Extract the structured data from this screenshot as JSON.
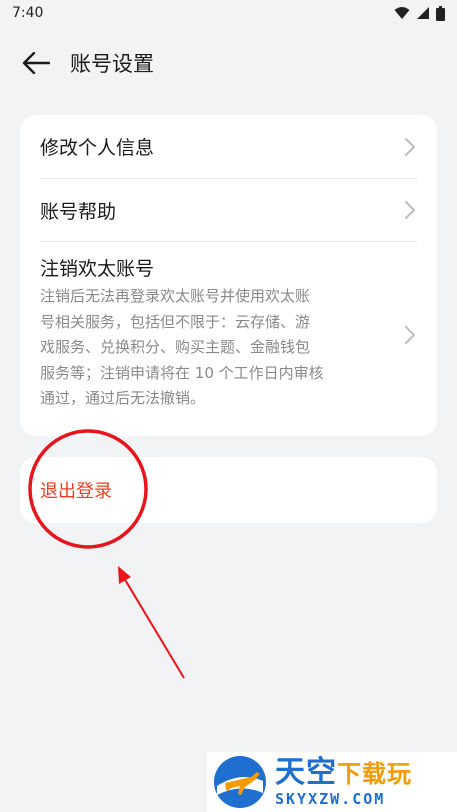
{
  "status_bar": {
    "time": "7:40",
    "icons": [
      "wifi-icon",
      "signal-icon",
      "battery-icon"
    ]
  },
  "header": {
    "back_icon": "arrow-left-icon",
    "title": "账号设置"
  },
  "menu": {
    "items": [
      {
        "label": "修改个人信息"
      },
      {
        "label": "账号帮助"
      },
      {
        "label": "注销欢太账号",
        "description_lines": [
          "注销后无法再登录欢太账号并使用欢太账",
          "号相关服务，包括但不限于：云存储、游",
          "戏服务、兑换积分、购买主题、金融钱包",
          "服务等；注销申请将在 10 个工作日内审核",
          "通过，通过后无法撤销。"
        ]
      }
    ]
  },
  "logout": {
    "label": "退出登录"
  },
  "watermark": {
    "title_main": "天空",
    "title_accent": "下载玩",
    "domain": "SKYXZW.COM"
  },
  "colors": {
    "background": "#f1f3f5",
    "card": "#ffffff",
    "logout_text": "#e84026",
    "annotation": "#e8141b",
    "watermark_blue": "#1e6fd0",
    "watermark_orange": "#f39b00"
  }
}
